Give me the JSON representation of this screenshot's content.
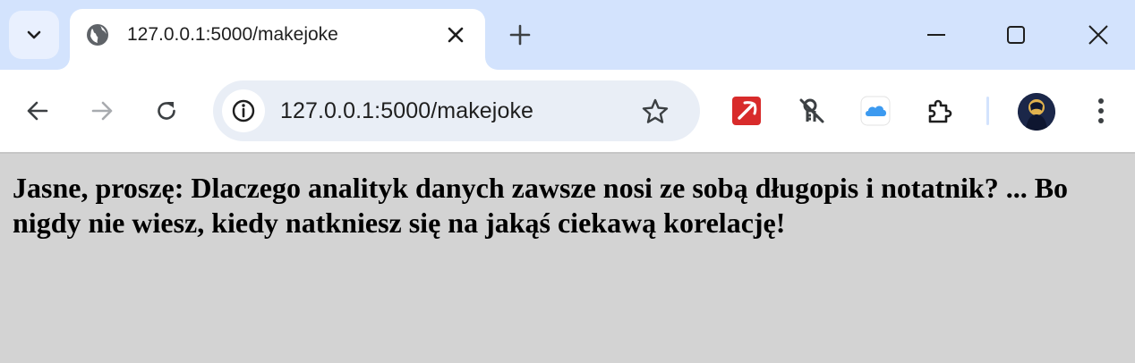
{
  "browser": {
    "tab": {
      "title": "127.0.0.1:5000/makejoke",
      "favicon": "globe-icon"
    },
    "new_tab_icon": "plus-icon",
    "tab_search_icon": "chevron-down-icon",
    "window_controls": [
      "minimize-icon",
      "maximize-icon",
      "close-icon"
    ],
    "toolbar": {
      "back_icon": "arrow-left-icon",
      "forward_icon": "arrow-right-icon",
      "reload_icon": "reload-icon",
      "site_info_icon": "info-icon",
      "url": "127.0.0.1:5000/makejoke",
      "bookmark_icon": "star-icon",
      "extensions": [
        "pickaxe-extension-icon",
        "key-off-extension-icon",
        "cloud-extension-icon",
        "puzzle-extensions-icon"
      ],
      "profile_icon": "avatar",
      "menu_icon": "more-vert-icon"
    },
    "colors": {
      "tabstrip": "#d3e3fd",
      "toolbar": "#ffffff",
      "omnibox": "#e9eef6",
      "page_background": "#d3d3d3"
    }
  },
  "page": {
    "joke_text": "Jasne, proszę: Dlaczego analityk danych zawsze nosi ze sobą długopis i notatnik? ... Bo nigdy nie wiesz, kiedy natkniesz się na jakąś ciekawą korelację!"
  }
}
